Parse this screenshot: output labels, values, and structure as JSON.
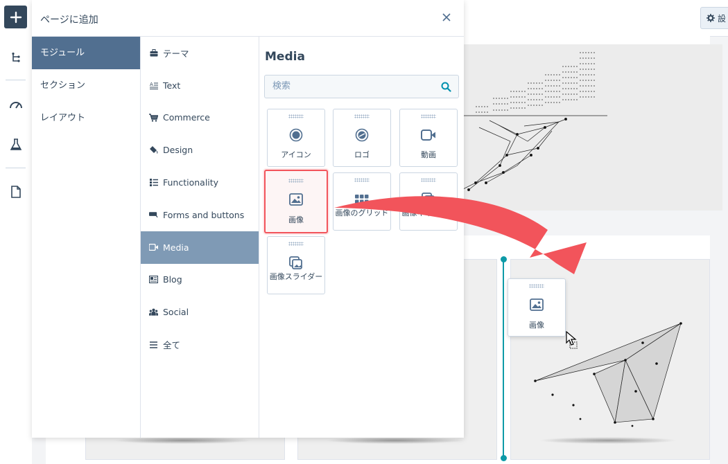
{
  "header": {
    "title": "ページに追加",
    "settings_label": "設"
  },
  "categories": [
    {
      "label": "モジュール",
      "active": true
    },
    {
      "label": "セクション",
      "active": false
    },
    {
      "label": "レイアウト",
      "active": false
    }
  ],
  "subcategories": [
    {
      "label": "テーマ",
      "icon": "briefcase-icon"
    },
    {
      "label": "Text",
      "icon": "text-icon"
    },
    {
      "label": "Commerce",
      "icon": "cart-icon"
    },
    {
      "label": "Design",
      "icon": "paint-bucket-icon"
    },
    {
      "label": "Functionality",
      "icon": "list-icon"
    },
    {
      "label": "Forms and buttons",
      "icon": "button-icon"
    },
    {
      "label": "Media",
      "icon": "video-icon",
      "active": true
    },
    {
      "label": "Blog",
      "icon": "newspaper-icon"
    },
    {
      "label": "Social",
      "icon": "people-icon"
    },
    {
      "label": "全て",
      "icon": "menu-icon"
    }
  ],
  "modules": {
    "title": "Media",
    "search_placeholder": "検索",
    "items": [
      {
        "label": "アイコン",
        "icon": "target-icon"
      },
      {
        "label": "ロゴ",
        "icon": "logo-icon"
      },
      {
        "label": "動画",
        "icon": "video-camera-icon"
      },
      {
        "label": "画像",
        "icon": "image-icon",
        "selected": true
      },
      {
        "label": "画像のグリッド",
        "icon": "grid-icon"
      },
      {
        "label": "画像ギャラリー",
        "icon": "gallery-icon"
      },
      {
        "label": "画像スライダー",
        "icon": "slider-icon"
      }
    ]
  },
  "drag_ghost": {
    "label": "画像"
  },
  "colors": {
    "accent": "#516f90",
    "selected_border": "#f2545b",
    "arrow": "#f2545b",
    "divider": "#0d9aa7"
  }
}
